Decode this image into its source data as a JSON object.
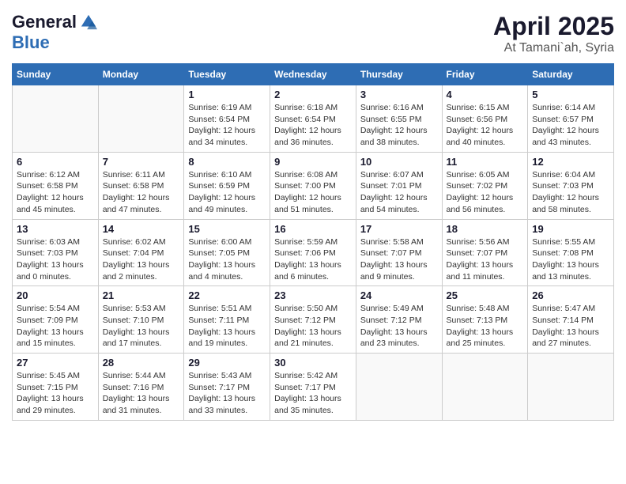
{
  "logo": {
    "general": "General",
    "blue": "Blue"
  },
  "title": "April 2025",
  "location": "At Tamani`ah, Syria",
  "days_of_week": [
    "Sunday",
    "Monday",
    "Tuesday",
    "Wednesday",
    "Thursday",
    "Friday",
    "Saturday"
  ],
  "weeks": [
    [
      {
        "day": "",
        "info": ""
      },
      {
        "day": "",
        "info": ""
      },
      {
        "day": "1",
        "info": "Sunrise: 6:19 AM\nSunset: 6:54 PM\nDaylight: 12 hours and 34 minutes."
      },
      {
        "day": "2",
        "info": "Sunrise: 6:18 AM\nSunset: 6:54 PM\nDaylight: 12 hours and 36 minutes."
      },
      {
        "day": "3",
        "info": "Sunrise: 6:16 AM\nSunset: 6:55 PM\nDaylight: 12 hours and 38 minutes."
      },
      {
        "day": "4",
        "info": "Sunrise: 6:15 AM\nSunset: 6:56 PM\nDaylight: 12 hours and 40 minutes."
      },
      {
        "day": "5",
        "info": "Sunrise: 6:14 AM\nSunset: 6:57 PM\nDaylight: 12 hours and 43 minutes."
      }
    ],
    [
      {
        "day": "6",
        "info": "Sunrise: 6:12 AM\nSunset: 6:58 PM\nDaylight: 12 hours and 45 minutes."
      },
      {
        "day": "7",
        "info": "Sunrise: 6:11 AM\nSunset: 6:58 PM\nDaylight: 12 hours and 47 minutes."
      },
      {
        "day": "8",
        "info": "Sunrise: 6:10 AM\nSunset: 6:59 PM\nDaylight: 12 hours and 49 minutes."
      },
      {
        "day": "9",
        "info": "Sunrise: 6:08 AM\nSunset: 7:00 PM\nDaylight: 12 hours and 51 minutes."
      },
      {
        "day": "10",
        "info": "Sunrise: 6:07 AM\nSunset: 7:01 PM\nDaylight: 12 hours and 54 minutes."
      },
      {
        "day": "11",
        "info": "Sunrise: 6:05 AM\nSunset: 7:02 PM\nDaylight: 12 hours and 56 minutes."
      },
      {
        "day": "12",
        "info": "Sunrise: 6:04 AM\nSunset: 7:03 PM\nDaylight: 12 hours and 58 minutes."
      }
    ],
    [
      {
        "day": "13",
        "info": "Sunrise: 6:03 AM\nSunset: 7:03 PM\nDaylight: 13 hours and 0 minutes."
      },
      {
        "day": "14",
        "info": "Sunrise: 6:02 AM\nSunset: 7:04 PM\nDaylight: 13 hours and 2 minutes."
      },
      {
        "day": "15",
        "info": "Sunrise: 6:00 AM\nSunset: 7:05 PM\nDaylight: 13 hours and 4 minutes."
      },
      {
        "day": "16",
        "info": "Sunrise: 5:59 AM\nSunset: 7:06 PM\nDaylight: 13 hours and 6 minutes."
      },
      {
        "day": "17",
        "info": "Sunrise: 5:58 AM\nSunset: 7:07 PM\nDaylight: 13 hours and 9 minutes."
      },
      {
        "day": "18",
        "info": "Sunrise: 5:56 AM\nSunset: 7:07 PM\nDaylight: 13 hours and 11 minutes."
      },
      {
        "day": "19",
        "info": "Sunrise: 5:55 AM\nSunset: 7:08 PM\nDaylight: 13 hours and 13 minutes."
      }
    ],
    [
      {
        "day": "20",
        "info": "Sunrise: 5:54 AM\nSunset: 7:09 PM\nDaylight: 13 hours and 15 minutes."
      },
      {
        "day": "21",
        "info": "Sunrise: 5:53 AM\nSunset: 7:10 PM\nDaylight: 13 hours and 17 minutes."
      },
      {
        "day": "22",
        "info": "Sunrise: 5:51 AM\nSunset: 7:11 PM\nDaylight: 13 hours and 19 minutes."
      },
      {
        "day": "23",
        "info": "Sunrise: 5:50 AM\nSunset: 7:12 PM\nDaylight: 13 hours and 21 minutes."
      },
      {
        "day": "24",
        "info": "Sunrise: 5:49 AM\nSunset: 7:12 PM\nDaylight: 13 hours and 23 minutes."
      },
      {
        "day": "25",
        "info": "Sunrise: 5:48 AM\nSunset: 7:13 PM\nDaylight: 13 hours and 25 minutes."
      },
      {
        "day": "26",
        "info": "Sunrise: 5:47 AM\nSunset: 7:14 PM\nDaylight: 13 hours and 27 minutes."
      }
    ],
    [
      {
        "day": "27",
        "info": "Sunrise: 5:45 AM\nSunset: 7:15 PM\nDaylight: 13 hours and 29 minutes."
      },
      {
        "day": "28",
        "info": "Sunrise: 5:44 AM\nSunset: 7:16 PM\nDaylight: 13 hours and 31 minutes."
      },
      {
        "day": "29",
        "info": "Sunrise: 5:43 AM\nSunset: 7:17 PM\nDaylight: 13 hours and 33 minutes."
      },
      {
        "day": "30",
        "info": "Sunrise: 5:42 AM\nSunset: 7:17 PM\nDaylight: 13 hours and 35 minutes."
      },
      {
        "day": "",
        "info": ""
      },
      {
        "day": "",
        "info": ""
      },
      {
        "day": "",
        "info": ""
      }
    ]
  ]
}
